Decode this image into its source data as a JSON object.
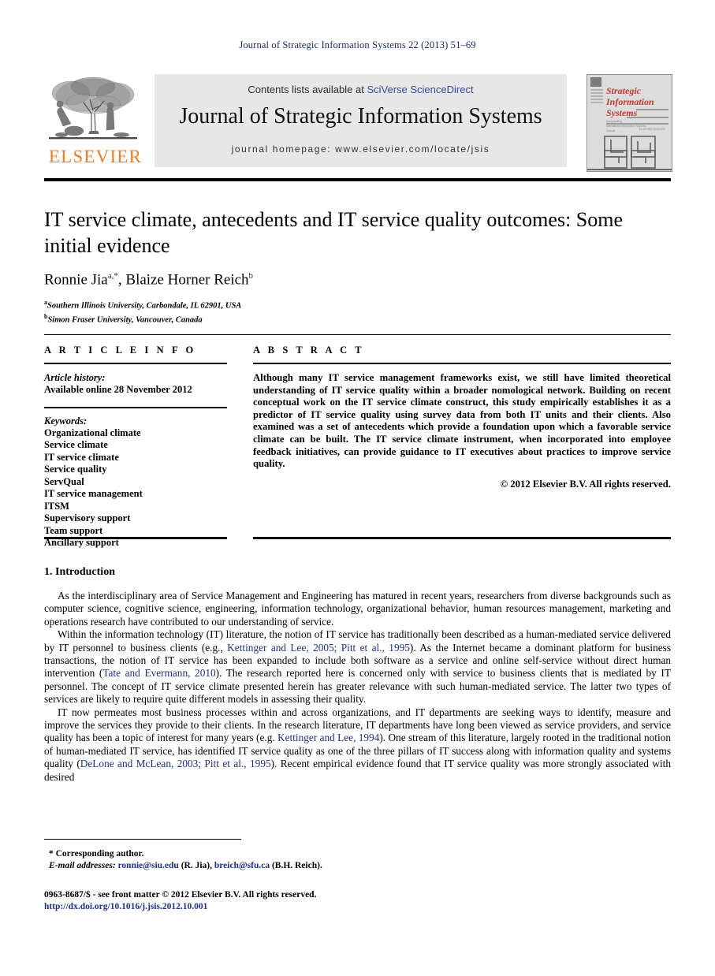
{
  "running_head": "Journal of Strategic Information Systems 22 (2013) 51–69",
  "masthead": {
    "contents_prefix": "Contents lists available at ",
    "contents_link": "SciVerse ScienceDirect",
    "journal_title": "Journal of Strategic Information Systems",
    "homepage": "journal homepage: www.elsevier.com/locate/jsis",
    "publisher_name": "ELSEVIER",
    "publisher_color": "#f07c21",
    "link_color": "#2f4da0",
    "cover_title_line1": "Strategic",
    "cover_title_line2": "Information",
    "cover_title_line3": "Systems",
    "cover_title_color": "#c0392b"
  },
  "article": {
    "title": "IT service climate, antecedents and IT service quality outcomes: Some initial evidence",
    "authors": [
      {
        "name": "Ronnie Jia",
        "marks": "a,*"
      },
      {
        "name": "Blaize Horner Reich",
        "marks": "b"
      }
    ],
    "affiliations": [
      {
        "mark": "a",
        "text": "Southern Illinois University, Carbondale, IL 62901, USA"
      },
      {
        "mark": "b",
        "text": "Simon Fraser University, Vancouver, Canada"
      }
    ]
  },
  "info": {
    "heading": "A R T I C L E   I N F O",
    "history_label": "Article history:",
    "history_value": "Available online 28 November 2012",
    "keywords_label": "Keywords:",
    "keywords": [
      "Organizational climate",
      "Service climate",
      "IT service climate",
      "Service quality",
      "ServQual",
      "IT service management",
      "ITSM",
      "Supervisory support",
      "Team support",
      "Ancillary support"
    ]
  },
  "abstract": {
    "heading": "A B S T R A C T",
    "text": "Although many IT service management frameworks exist, we still have limited theoretical understanding of IT service quality within a broader nomological network. Building on recent conceptual work on the IT service climate construct, this study empirically establishes it as a predictor of IT service quality using survey data from both IT units and their clients. Also examined was a set of antecedents which provide a foundation upon which a favorable service climate can be built. The IT service climate instrument, when incorporated into employee feedback initiatives, can provide guidance to IT executives about practices to improve service quality.",
    "copyright": "© 2012 Elsevier B.V. All rights reserved."
  },
  "body": {
    "section_heading": "1. Introduction",
    "paragraphs": [
      {
        "parts": [
          {
            "type": "text",
            "value": "As the interdisciplinary area of Service Management and Engineering has matured in recent years, researchers from diverse backgrounds such as computer science, cognitive science, engineering, information technology, organizational behavior, human resources management, marketing and operations research have contributed to our understanding of service."
          }
        ]
      },
      {
        "parts": [
          {
            "type": "text",
            "value": "Within the information technology (IT) literature, the notion of IT service has traditionally been described as a human-mediated service delivered by IT personnel to business clients (e.g., "
          },
          {
            "type": "cite",
            "value": "Kettinger and Lee, 2005; Pitt et al., 1995"
          },
          {
            "type": "text",
            "value": "). As the Internet became a dominant platform for business transactions, the notion of IT service has been expanded to include both software as a service and online self-service without direct human intervention ("
          },
          {
            "type": "cite",
            "value": "Tate and Evermann, 2010"
          },
          {
            "type": "text",
            "value": "). The research reported here is concerned only with service to business clients that is mediated by IT personnel. The concept of IT service climate presented herein has greater relevance with such human-mediated service. The latter two types of services are likely to require quite different models in assessing their quality."
          }
        ]
      },
      {
        "parts": [
          {
            "type": "text",
            "value": "IT now permeates most business processes within and across organizations, and IT departments are seeking ways to identify, measure and improve the services they provide to their clients. In the research literature, IT departments have long been viewed as service providers, and service quality has been a topic of interest for many years (e.g. "
          },
          {
            "type": "cite",
            "value": "Kettinger and Lee, 1994"
          },
          {
            "type": "text",
            "value": "). One stream of this literature, largely rooted in the traditional notion of human-mediated IT service, has identified IT service quality as one of the three pillars of IT success along with information quality and systems quality ("
          },
          {
            "type": "cite",
            "value": "DeLone and McLean, 2003; Pitt et al., 1995"
          },
          {
            "type": "text",
            "value": "). Recent empirical evidence found that IT service quality was more strongly associated with desired"
          }
        ]
      }
    ]
  },
  "footnotes": {
    "corresponding": "* Corresponding author.",
    "email_label": "E-mail addresses:",
    "email_1": "ronnie@siu.edu",
    "email_1_owner": "(R. Jia),",
    "email_2": "breich@sfu.ca",
    "email_2_owner": "(B.H. Reich)."
  },
  "colophon": {
    "issn_line": "0963-8687/$ - see front matter © 2012 Elsevier B.V. All rights reserved.",
    "doi": "http://dx.doi.org/10.1016/j.jsis.2012.10.001"
  }
}
